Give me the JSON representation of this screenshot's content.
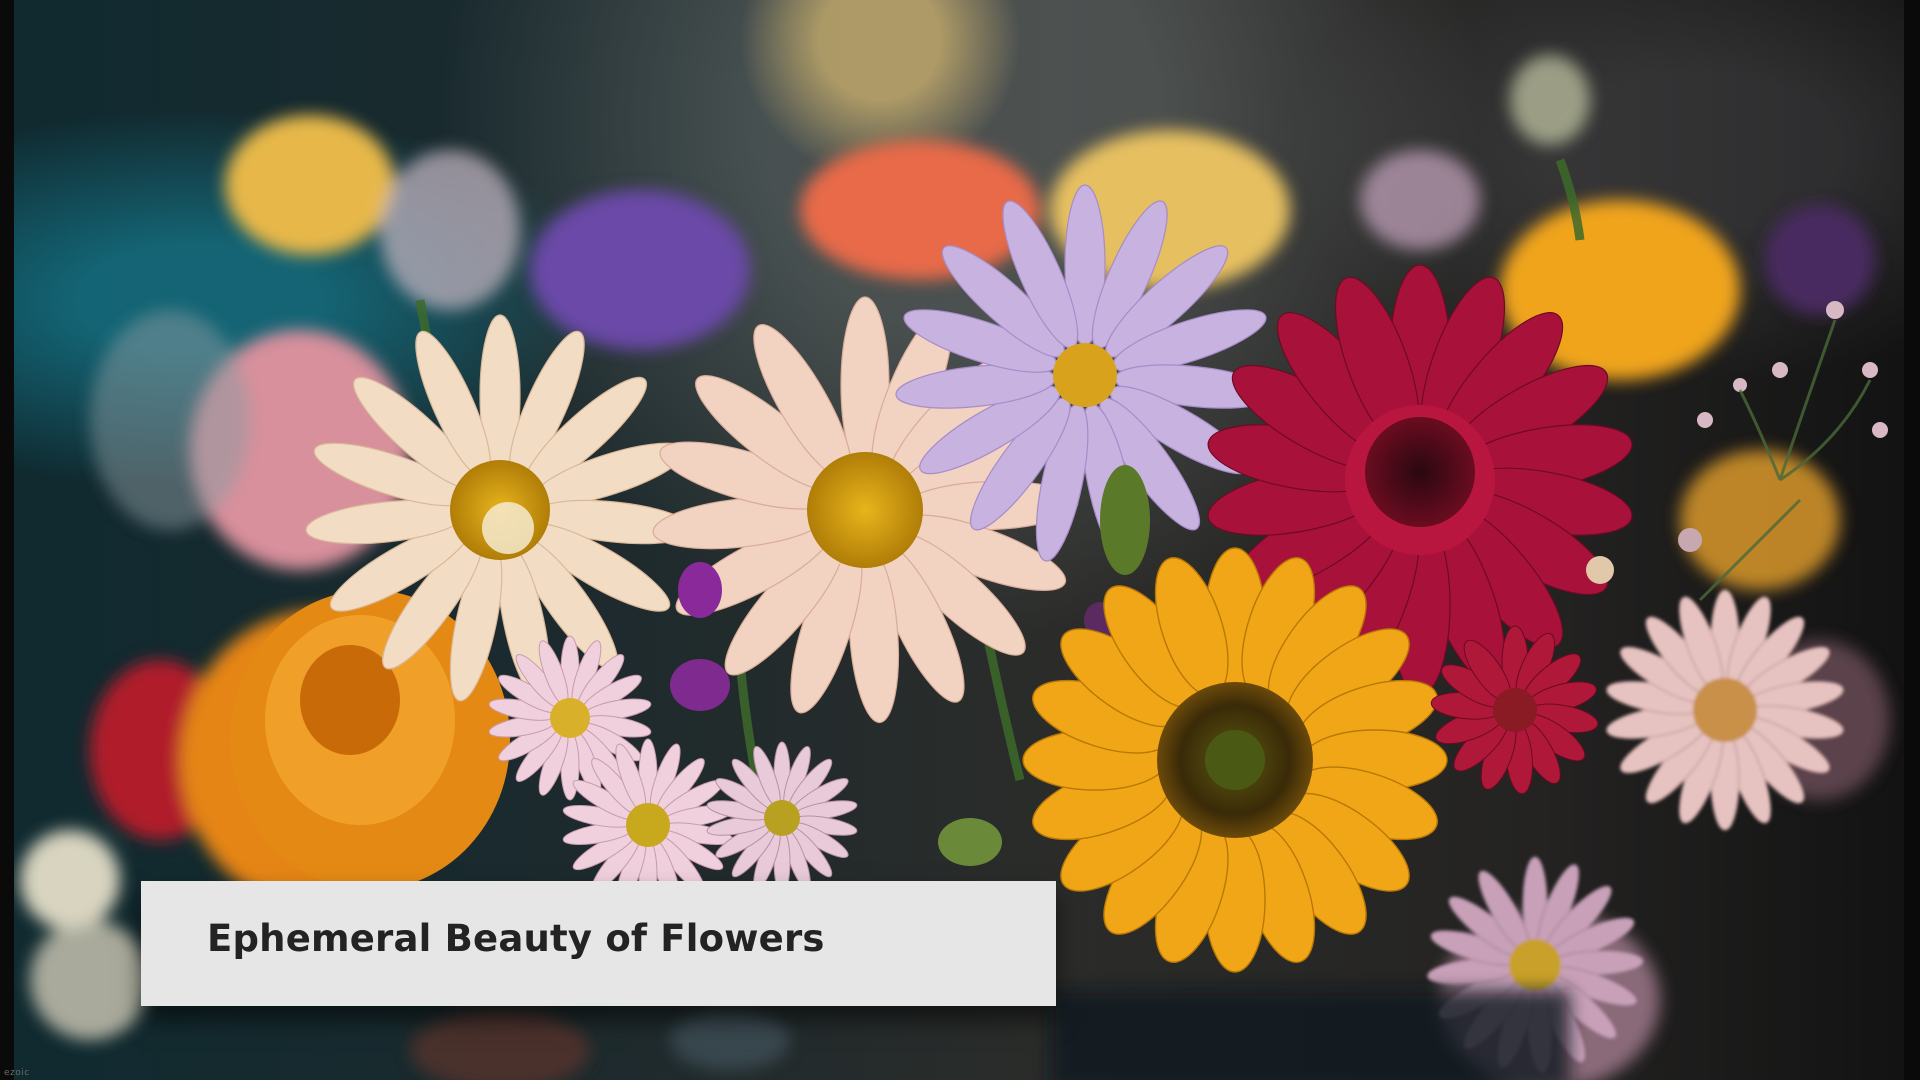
{
  "caption": {
    "title": "Ephemeral Beauty of Flowers"
  },
  "watermark": {
    "text": "ezoic"
  },
  "colors": {
    "caption_background": "#e6e6e6",
    "caption_text": "#232323"
  }
}
